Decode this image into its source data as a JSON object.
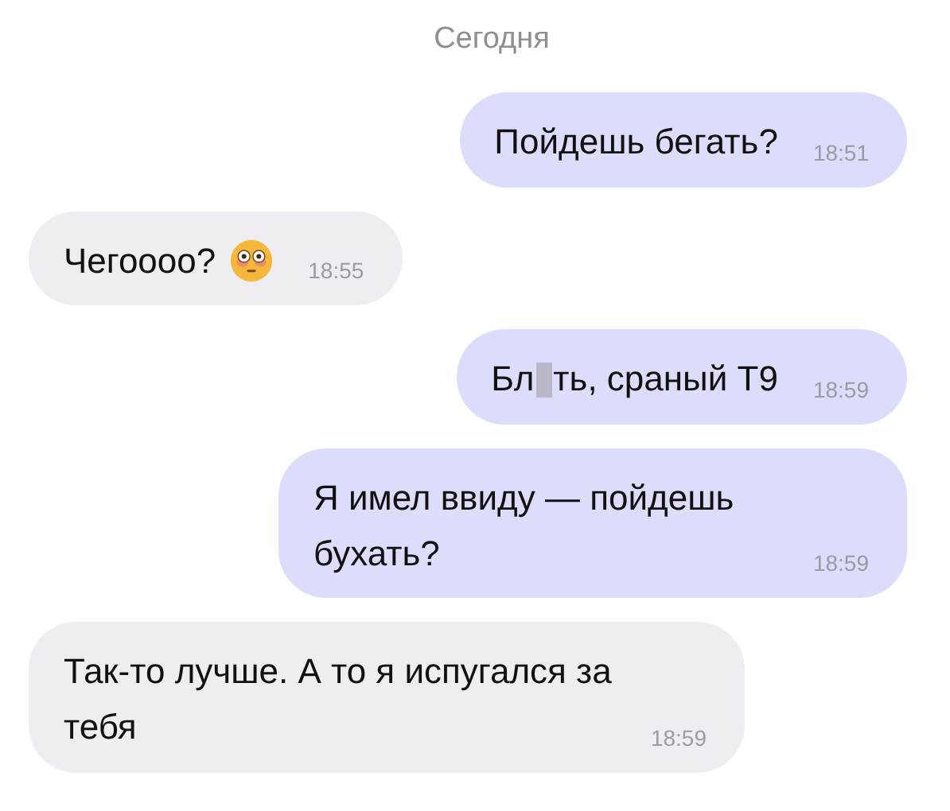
{
  "date_header": "Сегодня",
  "messages": [
    {
      "outgoing": true,
      "parts": [
        {
          "kind": "text",
          "text": "Пойдешь бегать?"
        }
      ],
      "time": "18:51"
    },
    {
      "outgoing": false,
      "parts": [
        {
          "kind": "text",
          "text": "Чегоооо?"
        },
        {
          "kind": "emoji"
        }
      ],
      "time": "18:55"
    },
    {
      "outgoing": true,
      "parts": [
        {
          "kind": "text",
          "text": "Бл"
        },
        {
          "kind": "censor"
        },
        {
          "kind": "text",
          "text": "ть, сраный Т9"
        }
      ],
      "time": "18:59"
    },
    {
      "outgoing": true,
      "parts": [
        {
          "kind": "text",
          "text": "Я имел ввиду — пойдешь бухать?"
        }
      ],
      "time": "18:59"
    },
    {
      "outgoing": false,
      "parts": [
        {
          "kind": "text",
          "text": "Так-то лучше. А то я испугался за тебя"
        }
      ],
      "time": "18:59"
    }
  ]
}
